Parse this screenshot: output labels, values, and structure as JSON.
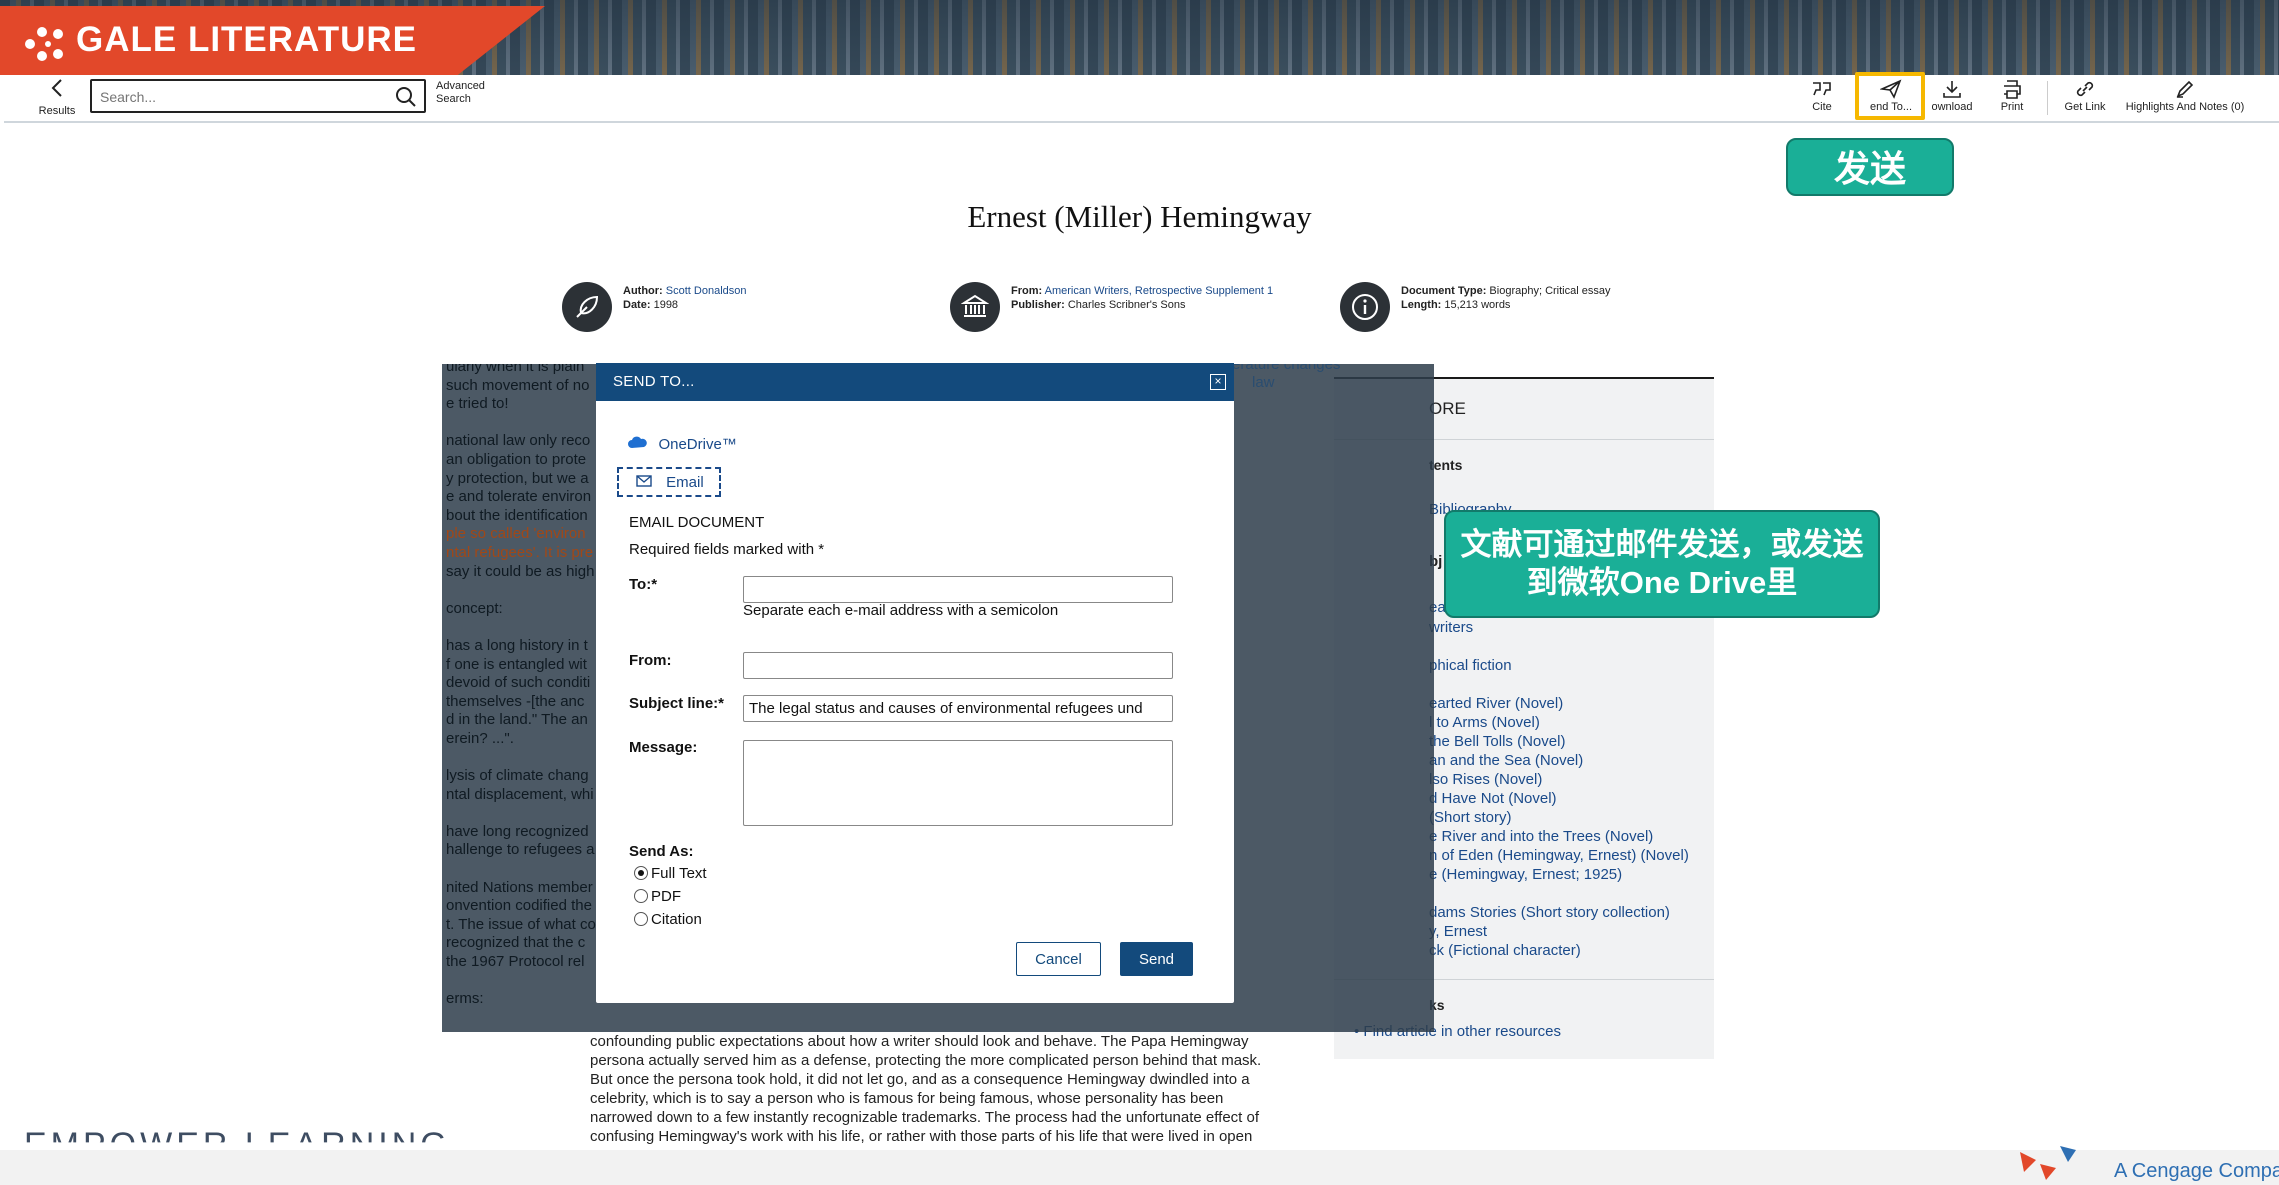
{
  "app": {
    "brand": "GALE LITERATURE"
  },
  "toolbar": {
    "back_label": "Results",
    "search_placeholder": "Search...",
    "advanced_search": "Advanced Search",
    "tools": {
      "cite": "Cite",
      "send_to": "end To...",
      "download": "ownload",
      "print": "Print",
      "get_link": "Get Link",
      "highlights": "Highlights And Notes (0)"
    }
  },
  "callouts": {
    "send": "发送",
    "email": "文献可通过邮件发送，或发送到微软One Drive里"
  },
  "document": {
    "title": "Ernest (Miller) Hemingway",
    "meta": {
      "author_label": "Author:",
      "author": "Scott Donaldson",
      "date_label": "Date:",
      "date": "1998",
      "from_label": "From:",
      "from": "American Writers, Retrospective Supplement 1",
      "publisher_label": "Publisher:",
      "publisher": "Charles Scribner's Sons",
      "type_label": "Document Type:",
      "type": "Biography; Critical essay",
      "length_label": "Length:",
      "length": "15,213 words"
    },
    "body_lines": [
      "confounding public expectations about how a writer should look and behave. The Papa Hemingway",
      "persona actually served him as a defense, protecting the more complicated person behind that mask.",
      "But once the persona took hold, it did not let go, and as a consequence Hemingway dwindled into a",
      "celebrity, which is to say a person who is famous for being famous, whose personality has been",
      "narrowed down to a few instantly recognizable trademarks. The process had the unfortunate effect of",
      "confusing Hemingway's work with his life, or rather with those parts of his life that were lived in open"
    ]
  },
  "background_article": {
    "lines": [
      "ularly when it is plain",
      "such movement of no",
      "e tried to!",
      "",
      "national law only reco",
      "an obligation to prote",
      "y protection, but we a",
      "e and tolerate environ",
      "bout the identification",
      "ple so called 'environ",
      "ntal refugees'. It is pre",
      "say it could be as high",
      "",
      "concept:",
      "",
      "has a long history in t",
      "f one is entangled wit",
      "devoid of such conditi",
      "themselves -[the anc",
      "d in the land.\" The an",
      "erein? ...\".",
      "",
      "lysis of climate chang",
      "ntal displacement, whi",
      "",
      "have long recognized",
      "hallenge to refugees a",
      "",
      "nited Nations member",
      "onvention codified the",
      "t. The issue of what co",
      "recognized that the c",
      "the 1967 Protocol rel",
      "",
      "erms:"
    ],
    "right_fragment_1": "erature changes",
    "right_fragment_2": "law"
  },
  "sidebar": {
    "heading": "ORE",
    "contents": "tents",
    "bibliography": "Bibliography",
    "subjects": "bj",
    "lines": [
      "ea",
      "writers",
      "phical fiction",
      "earted River (Novel)",
      "l to Arms (Novel)",
      "the Bell Tolls (Novel)",
      "an and the Sea (Novel)",
      "lso Rises (Novel)",
      "d Have Not (Novel)",
      "(Short story)",
      "e River and into the Trees (Novel)",
      "n of Eden (Hemingway, Ernest) (Novel)",
      "e (Hemingway, Ernest; 1925)",
      "dams Stories (Short story collection)",
      "y, Ernest",
      "ck (Fictional character)"
    ],
    "links_heading": "ks",
    "find_article": "Find article in other resources"
  },
  "modal": {
    "title": "SEND TO...",
    "close": "×",
    "onedrive": "OneDrive™",
    "email": "Email",
    "email_heading": "EMAIL DOCUMENT",
    "required_note": "Required fields marked with *",
    "to_label": "To:*",
    "to_value": "",
    "to_help": "Separate each e-mail address with a semicolon",
    "from_label": "From:",
    "from_value": "",
    "subject_label": "Subject line:*",
    "subject_value": "The legal status and causes of environmental refugees und",
    "message_label": "Message:",
    "message_value": "",
    "send_as_label": "Send As:",
    "send_as_options": [
      "Full Text",
      "PDF",
      "Citation"
    ],
    "send_as_selected": "Full Text",
    "cancel": "Cancel",
    "send": "Send"
  },
  "footer": {
    "left_text": "EMPOWER LEARNING",
    "right_text": "A Cengage Compa"
  },
  "colors": {
    "brand_orange": "#e2482a",
    "modal_blue": "#134a7c",
    "callout_teal": "#1aaf97",
    "highlight_yellow": "#f6b800",
    "link_blue": "#1a4a8a"
  }
}
